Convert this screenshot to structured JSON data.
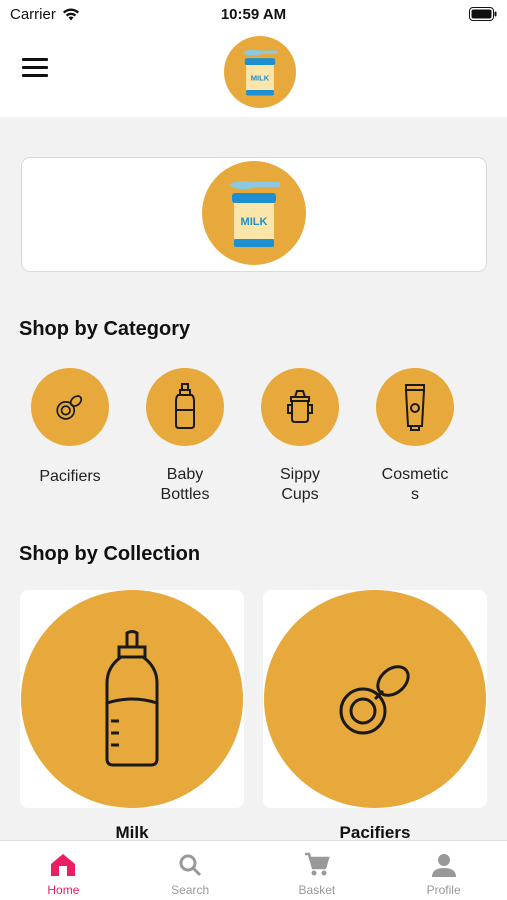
{
  "status_bar": {
    "carrier": "Carrier",
    "time": "10:59 AM"
  },
  "header": {
    "menu_icon": "hamburger-icon",
    "logo_icon": "milk-can-icon"
  },
  "banner": {
    "logo_icon": "milk-can-icon"
  },
  "sections": {
    "category_title": "Shop by Category",
    "collection_title": "Shop by Collection"
  },
  "categories": [
    {
      "label": "Pacifiers",
      "icon": "pacifier-icon"
    },
    {
      "label": "Baby\nBottles",
      "icon": "baby-bottle-icon"
    },
    {
      "label": "Sippy\nCups",
      "icon": "sippy-cup-icon"
    },
    {
      "label": "Cosmetic\ns",
      "icon": "cosmetics-tube-icon"
    }
  ],
  "collections": [
    {
      "label": "Milk",
      "icon": "baby-bottle-icon"
    },
    {
      "label": "Pacifiers",
      "icon": "pacifier-icon"
    }
  ],
  "tabs": [
    {
      "label": "Home",
      "icon": "home-icon",
      "active": true
    },
    {
      "label": "Search",
      "icon": "search-icon",
      "active": false
    },
    {
      "label": "Basket",
      "icon": "cart-icon",
      "active": false
    },
    {
      "label": "Profile",
      "icon": "person-icon",
      "active": false
    }
  ],
  "colors": {
    "accent": "#e8a93c",
    "active_tab": "#e91e63",
    "inactive_tab": "#999999"
  }
}
